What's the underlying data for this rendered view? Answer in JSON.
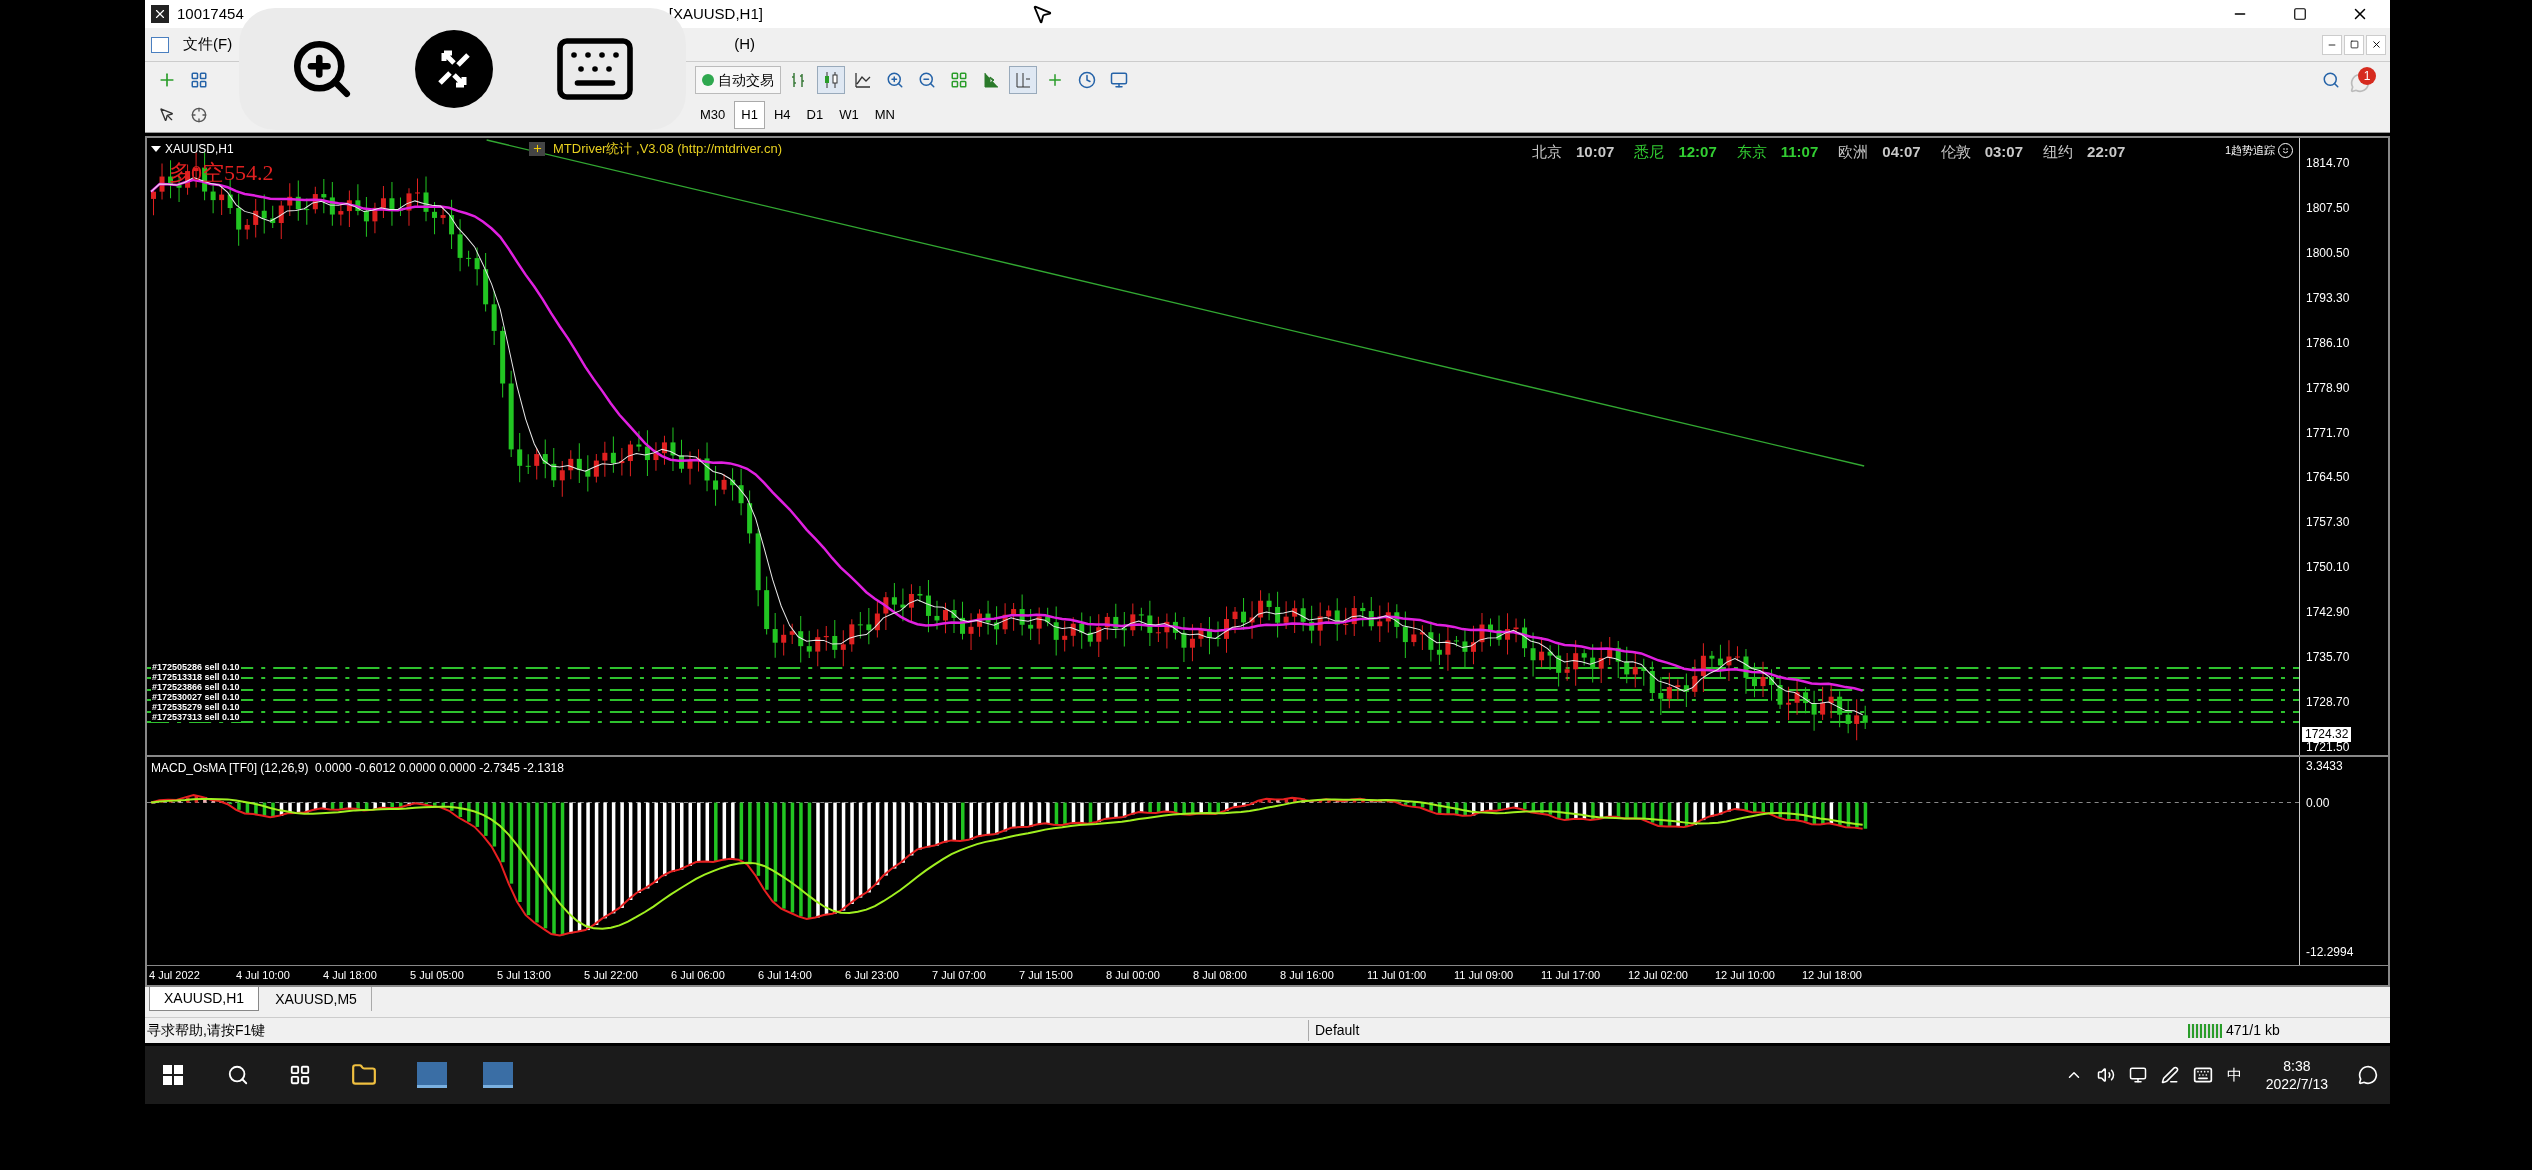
{
  "window": {
    "title_prefix": "10017454",
    "title_suffix": "[XAUUSD,H1]"
  },
  "menu": [
    {
      "label": "文件(F)"
    },
    {
      "label": "(H)"
    }
  ],
  "toolbar": {
    "auto_trade": "自动交易",
    "notifications": "1",
    "timeframes": [
      {
        "label": "M30",
        "selected": false
      },
      {
        "label": "H1",
        "selected": true
      },
      {
        "label": "H4",
        "selected": false
      },
      {
        "label": "D1",
        "selected": false
      },
      {
        "label": "W1",
        "selected": false
      },
      {
        "label": "MN",
        "selected": false
      }
    ]
  },
  "chart": {
    "symbol": "XAUUSD,H1",
    "stats": "多0空554.2",
    "indicator_label": "MTDriver统计 ,V3.08 (http://mtdriver.cn)",
    "clocks": [
      {
        "city": "北京",
        "time": "10:07",
        "color": "#c8c8c8"
      },
      {
        "city": "悉尼",
        "time": "12:07",
        "color": "#32cd32"
      },
      {
        "city": "东京",
        "time": "11:07",
        "color": "#32cd32"
      },
      {
        "city": "欧洲",
        "time": "04:07",
        "color": "#c8c8c8"
      },
      {
        "city": "伦敦",
        "time": "03:07",
        "color": "#c8c8c8"
      },
      {
        "city": "纽约",
        "time": "22:07",
        "color": "#c8c8c8"
      }
    ],
    "trend_label": "1趋势追踪",
    "price_ticks": [
      "1814.70",
      "1807.50",
      "1800.50",
      "1793.30",
      "1786.10",
      "1778.90",
      "1771.70",
      "1764.50",
      "1757.30",
      "1750.10",
      "1742.90",
      "1735.70",
      "1728.70",
      "1721.50"
    ],
    "current_price": "1724.32",
    "orders": [
      "#172505286 sell 0.10",
      "#172513318 sell 0.10",
      "#172523866 sell 0.10",
      "#172530027 sell 0.10",
      "#172535279 sell 0.10",
      "#172537313 sell 0.10"
    ],
    "macd": {
      "label": "MACD_OsMA [TF0] (12,26,9)  0.0000 -0.6012 0.0000 0.0000 -2.7345 -2.1318",
      "ticks": [
        "3.3433",
        "0.00",
        "-12.2994"
      ]
    },
    "time_ticks": [
      "4 Jul 2022",
      "4 Jul 10:00",
      "4 Jul 18:00",
      "5 Jul 05:00",
      "5 Jul 13:00",
      "5 Jul 22:00",
      "6 Jul 06:00",
      "6 Jul 14:00",
      "6 Jul 23:00",
      "7 Jul 07:00",
      "7 Jul 15:00",
      "8 Jul 00:00",
      "8 Jul 08:00",
      "8 Jul 16:00",
      "11 Jul 01:00",
      "11 Jul 09:00",
      "11 Jul 17:00",
      "12 Jul 02:00",
      "12 Jul 10:00",
      "12 Jul 18:00"
    ]
  },
  "tabs": [
    {
      "label": "XAUUSD,H1",
      "selected": true
    },
    {
      "label": "XAUUSD,M5",
      "selected": false
    }
  ],
  "status_bar": {
    "help": "寻求帮助,请按F1键",
    "profile": "Default",
    "traffic": "471/1 kb"
  },
  "taskbar": {
    "ime": "中",
    "time": "8:38",
    "date": "2022/7/13"
  }
}
